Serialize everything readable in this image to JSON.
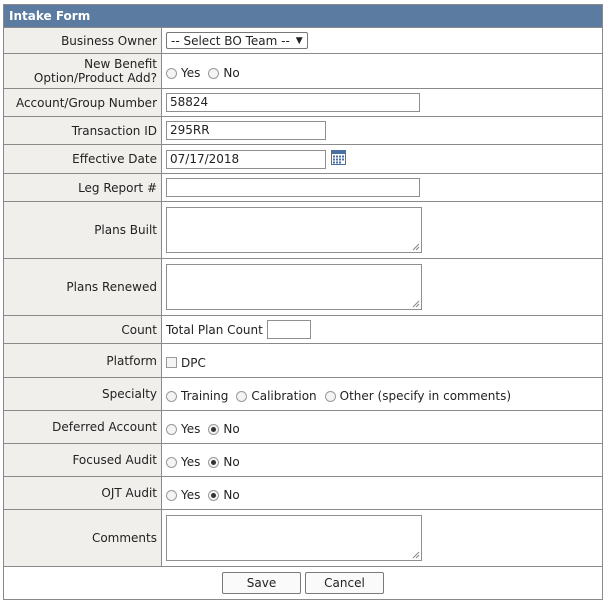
{
  "form_title": "Intake Form",
  "business_owner": {
    "label": "Business Owner",
    "selected": "-- Select BO Team --"
  },
  "new_benefit": {
    "label_line1": "New Benefit",
    "label_line2": "Option/Product Add?",
    "options": [
      "Yes",
      "No"
    ],
    "selected": null
  },
  "account_group": {
    "label": "Account/Group Number",
    "value": "58824"
  },
  "transaction_id": {
    "label": "Transaction ID",
    "value": "295RR"
  },
  "effective_date": {
    "label": "Effective Date",
    "value": "07/17/2018"
  },
  "leg_report": {
    "label": "Leg Report #",
    "value": ""
  },
  "plans_built": {
    "label": "Plans Built",
    "value": ""
  },
  "plans_renewed": {
    "label": "Plans Renewed",
    "value": ""
  },
  "count": {
    "label": "Count",
    "text": "Total Plan Count",
    "value": ""
  },
  "platform": {
    "label": "Platform",
    "option": "DPC",
    "checked": false
  },
  "specialty": {
    "label": "Specialty",
    "options": [
      "Training",
      "Calibration",
      "Other (specify in comments)"
    ],
    "selected": null
  },
  "deferred_account": {
    "label": "Deferred Account",
    "options": [
      "Yes",
      "No"
    ],
    "selected": "No"
  },
  "focused_audit": {
    "label": "Focused Audit",
    "options": [
      "Yes",
      "No"
    ],
    "selected": "No"
  },
  "ojt_audit": {
    "label": "OJT Audit",
    "options": [
      "Yes",
      "No"
    ],
    "selected": "No"
  },
  "comments": {
    "label": "Comments",
    "value": ""
  },
  "buttons": {
    "save": "Save",
    "cancel": "Cancel"
  }
}
